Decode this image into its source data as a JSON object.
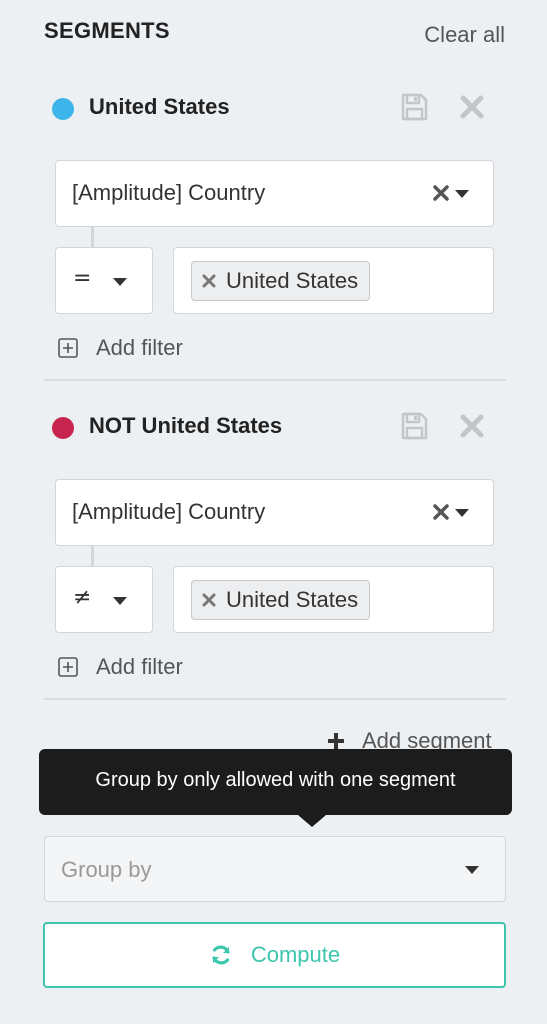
{
  "header": {
    "title": "SEGMENTS",
    "clear_all": "Clear all"
  },
  "segments": [
    {
      "name": "United States",
      "color": "#3db5ea",
      "filter": {
        "property": "[Amplitude] Country",
        "operator": "=",
        "values": [
          "United States"
        ]
      },
      "add_filter": "Add filter",
      "icons": [
        "save-icon",
        "delete-icon",
        "clear-icon",
        "chevron-down-icon",
        "remove-chip-icon",
        "plus-square-icon"
      ]
    },
    {
      "name": "NOT United States",
      "color": "#c82450",
      "filter": {
        "property": "[Amplitude] Country",
        "operator": "≠",
        "values": [
          "United States"
        ]
      },
      "add_filter": "Add filter",
      "icons": [
        "save-icon",
        "delete-icon",
        "clear-icon",
        "chevron-down-icon",
        "remove-chip-icon",
        "plus-square-icon"
      ]
    }
  ],
  "add_segment": "Add segment",
  "tooltip": "Group by only allowed with one segment",
  "group_by": {
    "placeholder": "Group by"
  },
  "compute": {
    "label": "Compute",
    "icon": "refresh-icon"
  },
  "colors": {
    "accent": "#3ec5ae",
    "muted_icon": "#c2c6ca"
  }
}
